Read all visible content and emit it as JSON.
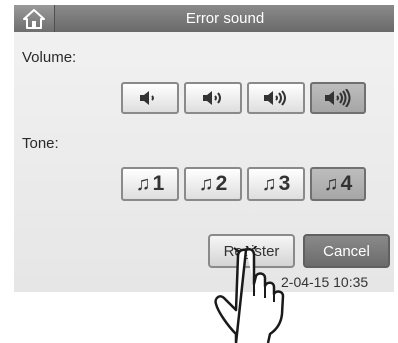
{
  "header": {
    "title": "Error sound",
    "home_icon": "home-icon"
  },
  "volume": {
    "label": "Volume:",
    "options": [
      {
        "icon": "speaker-level-1-icon",
        "selected": false
      },
      {
        "icon": "speaker-level-2-icon",
        "selected": false
      },
      {
        "icon": "speaker-level-3-icon",
        "selected": false
      },
      {
        "icon": "speaker-level-4-icon",
        "selected": true
      }
    ]
  },
  "tone": {
    "label": "Tone:",
    "options": [
      {
        "icon": "music-note-icon",
        "text": "1",
        "selected": false
      },
      {
        "icon": "music-note-icon",
        "text": "2",
        "selected": false
      },
      {
        "icon": "music-note-icon",
        "text": "3",
        "selected": false
      },
      {
        "icon": "music-note-icon",
        "text": "4",
        "selected": true
      }
    ]
  },
  "actions": {
    "register_label": "Register",
    "cancel_label": "Cancel"
  },
  "status": {
    "datetime": "2-04-15 10:35"
  },
  "colors": {
    "titlebar": "#7a7a7a",
    "selected": "#b0b0b0",
    "cancel": "#7a7a7a"
  },
  "overlay": {
    "icon": "pointing-hand-icon"
  }
}
